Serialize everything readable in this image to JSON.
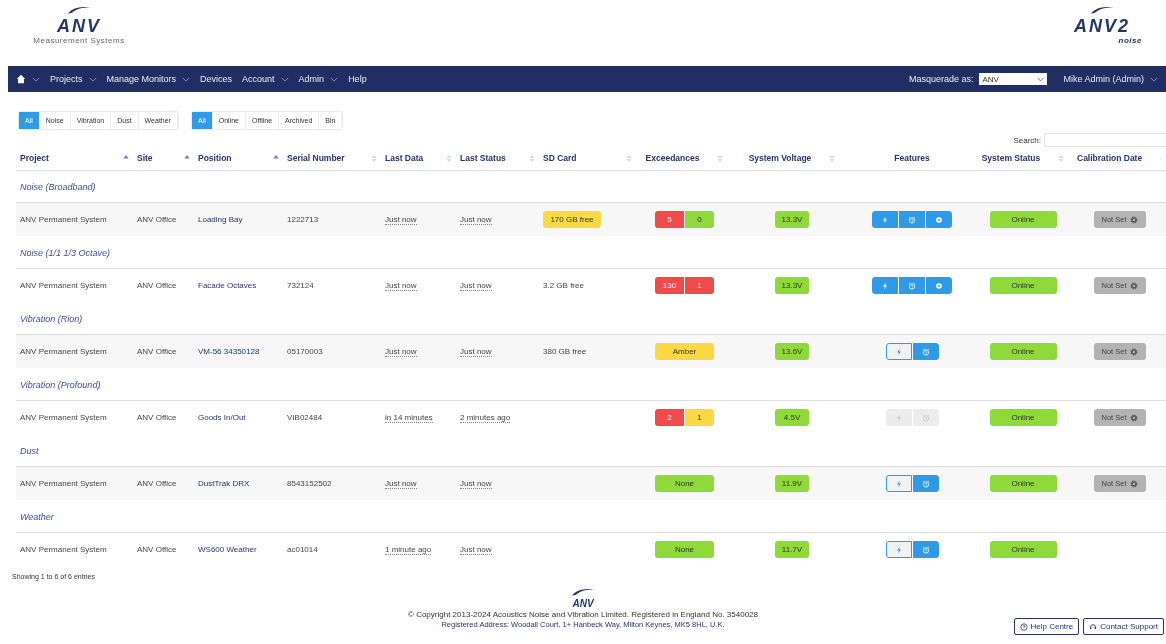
{
  "header": {
    "left_logo": {
      "text": "ANV",
      "tagline": "Measurement Systems"
    },
    "right_logo": {
      "text": "ANV2",
      "tagline": "noise"
    }
  },
  "nav": {
    "items": [
      {
        "label": "Projects",
        "dropdown": true
      },
      {
        "label": "Manage Monitors",
        "dropdown": true
      },
      {
        "label": "Devices",
        "dropdown": false
      },
      {
        "label": "Account",
        "dropdown": true
      },
      {
        "label": "Admin",
        "dropdown": true
      },
      {
        "label": "Help",
        "dropdown": false
      }
    ],
    "masquerade_label": "Masquerade as:",
    "masquerade_value": "ANV",
    "user": "Mike Admin (Admin)"
  },
  "filters": [
    [
      {
        "label": "All",
        "selected": true
      },
      {
        "label": "Noise",
        "selected": false
      },
      {
        "label": "Vibration",
        "selected": false
      },
      {
        "label": "Dust",
        "selected": false
      },
      {
        "label": "Weather",
        "selected": false
      }
    ],
    [
      {
        "label": "All",
        "selected": true
      },
      {
        "label": "Online",
        "selected": false
      },
      {
        "label": "Offline",
        "selected": false
      },
      {
        "label": "Archived",
        "selected": false
      },
      {
        "label": "Bin",
        "selected": false
      }
    ]
  ],
  "search": {
    "label": "Search:"
  },
  "table": {
    "columns": [
      {
        "label": "Project",
        "kind": "sorted"
      },
      {
        "label": "Site",
        "kind": "sorted"
      },
      {
        "label": "Position",
        "kind": "sorted"
      },
      {
        "label": "Serial Number",
        "kind": "sortable"
      },
      {
        "label": "Last Data",
        "kind": "sortable"
      },
      {
        "label": "Last Status",
        "kind": "sortable"
      },
      {
        "label": "SD Card",
        "kind": "sortable"
      },
      {
        "label": "Exceedances",
        "kind": "sortable"
      },
      {
        "label": "System Voltage",
        "kind": "sortable"
      },
      {
        "label": "Features",
        "kind": "plain"
      },
      {
        "label": "System Status",
        "kind": "sortable"
      },
      {
        "label": "Calibration Date",
        "kind": "sortable"
      }
    ],
    "groups": [
      {
        "title": "Noise (Broadband)",
        "rows": [
          {
            "project": "ANV Permanent System",
            "site": "ANV Office",
            "position": "Loading Bay",
            "serial": "1222713",
            "last_data": "Just now",
            "last_status": "Just now",
            "sd_card": {
              "text": "170 GB free",
              "color": "#fbd945"
            },
            "exceedances": [
              {
                "text": "5",
                "color": "#ef4b4b"
              },
              {
                "text": "0",
                "color": "#8fd93a"
              }
            ],
            "voltage": "13.3V",
            "features": [
              {
                "kind": "bolt",
                "on": true,
                "disabled": false
              },
              {
                "kind": "alarm",
                "on": true,
                "disabled": false
              },
              {
                "kind": "dot",
                "on": true,
                "disabled": false
              }
            ],
            "status": "Online",
            "calibration": "Not Set"
          }
        ]
      },
      {
        "title": "Noise (1/1 1/3 Octave)",
        "rows": [
          {
            "project": "ANV Permanent System",
            "site": "ANV Office",
            "position": "Facade Octaves",
            "serial": "732124",
            "last_data": "Just now",
            "last_status": "Just now",
            "sd_card": {
              "text": "3.2 GB free"
            },
            "exceedances": [
              {
                "text": "130",
                "color": "#ef4b4b"
              },
              {
                "text": "1",
                "color": "#ef4b4b"
              }
            ],
            "voltage": "13.3V",
            "features": [
              {
                "kind": "bolt",
                "on": true,
                "disabled": false
              },
              {
                "kind": "alarm",
                "on": true,
                "disabled": false
              },
              {
                "kind": "dot",
                "on": true,
                "disabled": false
              }
            ],
            "status": "Online",
            "calibration": "Not Set"
          }
        ]
      },
      {
        "title": "Vibration (Rion)",
        "rows": [
          {
            "project": "ANV Permanent System",
            "site": "ANV Office",
            "position": "VM-56 34350128",
            "serial": "05170003",
            "last_data": "Just now",
            "last_status": "Just now",
            "sd_card": {
              "text": "380 GB free"
            },
            "exceedances": [
              {
                "text": "Amber",
                "color": "#fbd945"
              }
            ],
            "voltage": "13.6V",
            "features": [
              {
                "kind": "bolt",
                "on": false,
                "disabled": false
              },
              {
                "kind": "alarm",
                "on": true,
                "disabled": false
              }
            ],
            "status": "Online",
            "calibration": "Not Set"
          }
        ]
      },
      {
        "title": "Vibration (Profound)",
        "rows": [
          {
            "project": "ANV Permanent System",
            "site": "ANV Office",
            "position": "Goods In/Out",
            "serial": "VIB02484",
            "last_data": "in 14 minutes",
            "last_status": "2 minutes ago",
            "exceedances": [
              {
                "text": "2",
                "color": "#ef4b4b"
              },
              {
                "text": "1",
                "color": "#fbd945"
              }
            ],
            "voltage": "4.5V",
            "features": [
              {
                "kind": "bolt",
                "disabled": true
              },
              {
                "kind": "alarm",
                "disabled": true
              }
            ],
            "status": "Online",
            "calibration": "Not Set"
          }
        ]
      },
      {
        "title": "Dust",
        "rows": [
          {
            "project": "ANV Permanent System",
            "site": "ANV Office",
            "position": "DustTrak DRX",
            "serial": "8543152502",
            "last_data": "Just now",
            "last_status": "Just now",
            "exceedances": [
              {
                "text": "None",
                "color": "#8fd93a"
              }
            ],
            "voltage": "11.9V",
            "features": [
              {
                "kind": "bolt",
                "on": false,
                "disabled": false
              },
              {
                "kind": "alarm",
                "on": true,
                "disabled": false
              }
            ],
            "status": "Online",
            "calibration": "Not Set"
          }
        ]
      },
      {
        "title": "Weather",
        "rows": [
          {
            "project": "ANV Permanent System",
            "site": "ANV Office",
            "position": "WS600 Weather",
            "serial": "ac01014",
            "last_data": "1 minute ago",
            "last_status": "Just now",
            "exceedances": [
              {
                "text": "None",
                "color": "#8fd93a"
              }
            ],
            "voltage": "11.7V",
            "features": [
              {
                "kind": "bolt",
                "on": false,
                "disabled": false
              },
              {
                "kind": "alarm",
                "on": true,
                "disabled": false
              }
            ],
            "status": "Online"
          }
        ]
      }
    ]
  },
  "info": "Showing 1 to 6 of 6 entries",
  "footer": {
    "logo_text": "ANV",
    "copyright": "© Copyright 2013-2024 Acoustics Noise and Vibration Limited. Registered in England No. 3540028",
    "address": "Registered Address: Woodall Court, 1+ Hanbeck Way, Milton Keynes, MK5 8HL, U.K.",
    "buttons": [
      {
        "kind": "help",
        "label": "Help Centre"
      },
      {
        "kind": "support",
        "label": "Contact Support"
      }
    ]
  }
}
